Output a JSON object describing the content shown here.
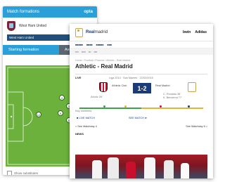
{
  "opta": {
    "header_title": "Match formations",
    "logo": "opta",
    "team_name": "West Ham United",
    "team_select": "West Ham United",
    "tabs": [
      "Starting formation",
      "Average"
    ],
    "players": [
      "4",
      "3",
      "12",
      "9",
      "6",
      "12"
    ],
    "show_subs": "Show substitutes"
  },
  "rm": {
    "brand_prefix": "Real",
    "brand_suffix": "madrid",
    "sponsors": [
      "bwin",
      "Adidas"
    ],
    "crumbs": "Home / Football / Fixtures / Athletic - Real Madrid",
    "title": "Athletic - Real Madrid",
    "live": "LIVE",
    "meta": "Liga 2014 · San Mamés · 22/02/2015",
    "home_team": "Athletic Club",
    "away_team": "Real Madrid",
    "score": "1-2",
    "home_scorer": "Aduriz 26'",
    "away_scorers": [
      "C. Ronaldo 38'",
      "K. Benzema 77'"
    ],
    "timeline_label": "Key moments",
    "summary_link": "■ LIVE MATCH",
    "see_link": "SEE MATCH ►",
    "prev_link": "< See Matchday 4",
    "next_link": "See Matchday 6 >",
    "news_heading": "NEWS"
  },
  "colors": {
    "opta_blue": "#2a9fd8",
    "pitch_green": "#6bb13c",
    "rm_navy": "#1a3a7a"
  }
}
